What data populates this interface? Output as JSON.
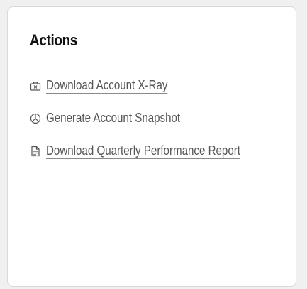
{
  "card": {
    "title": "Actions",
    "actions": [
      {
        "label": "Download Account X-Ray",
        "icon": "xray-download-icon"
      },
      {
        "label": "Generate Account Snapshot",
        "icon": "pie-chart-icon"
      },
      {
        "label": "Download Quarterly Performance Report",
        "icon": "document-icon"
      }
    ]
  }
}
